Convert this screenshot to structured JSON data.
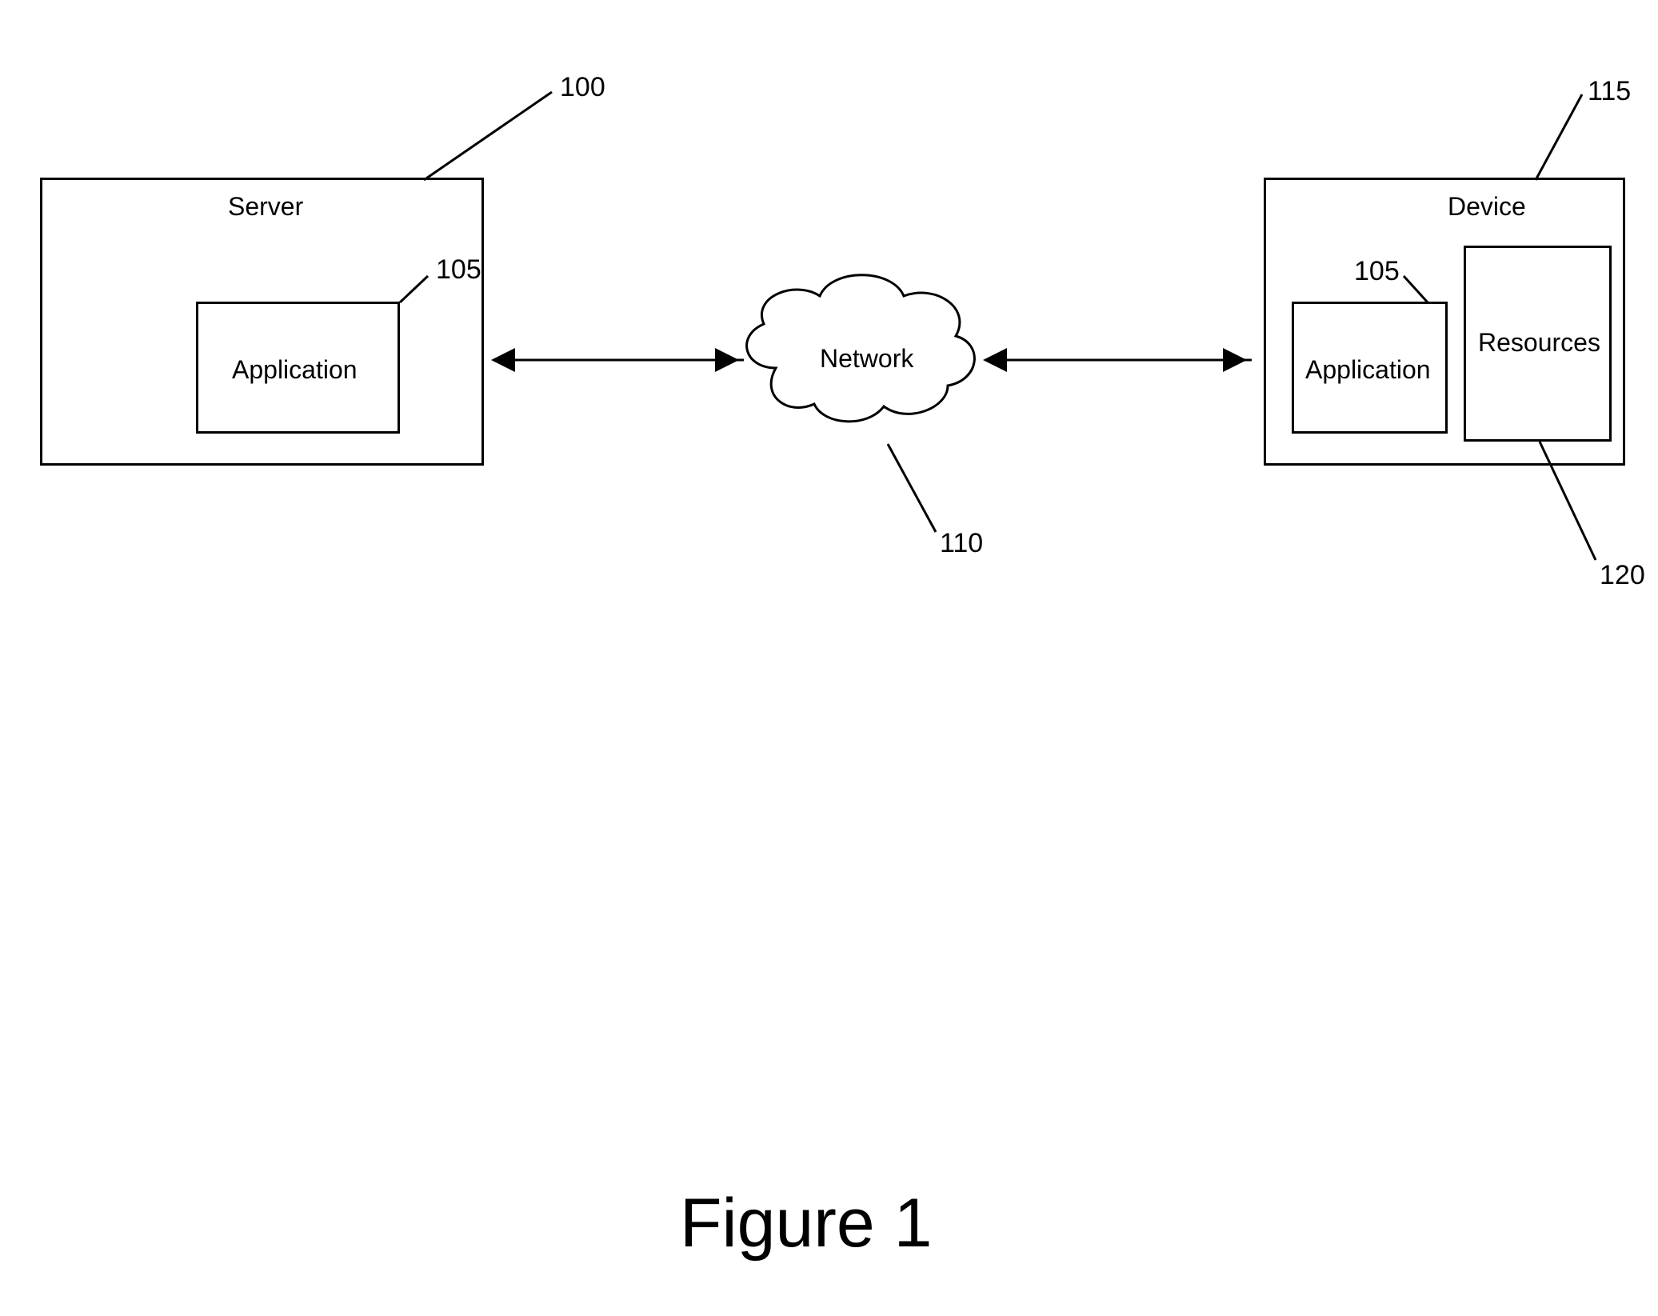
{
  "figure_title": "Figure 1",
  "nodes": {
    "server": {
      "label": "Server",
      "ref": "100"
    },
    "server_app": {
      "label": "Application",
      "ref": "105"
    },
    "network": {
      "label": "Network",
      "ref": "110"
    },
    "device": {
      "label": "Device",
      "ref": "115"
    },
    "device_app": {
      "label": "Application",
      "ref": "105"
    },
    "resources": {
      "label": "Resources",
      "ref": "120"
    }
  }
}
